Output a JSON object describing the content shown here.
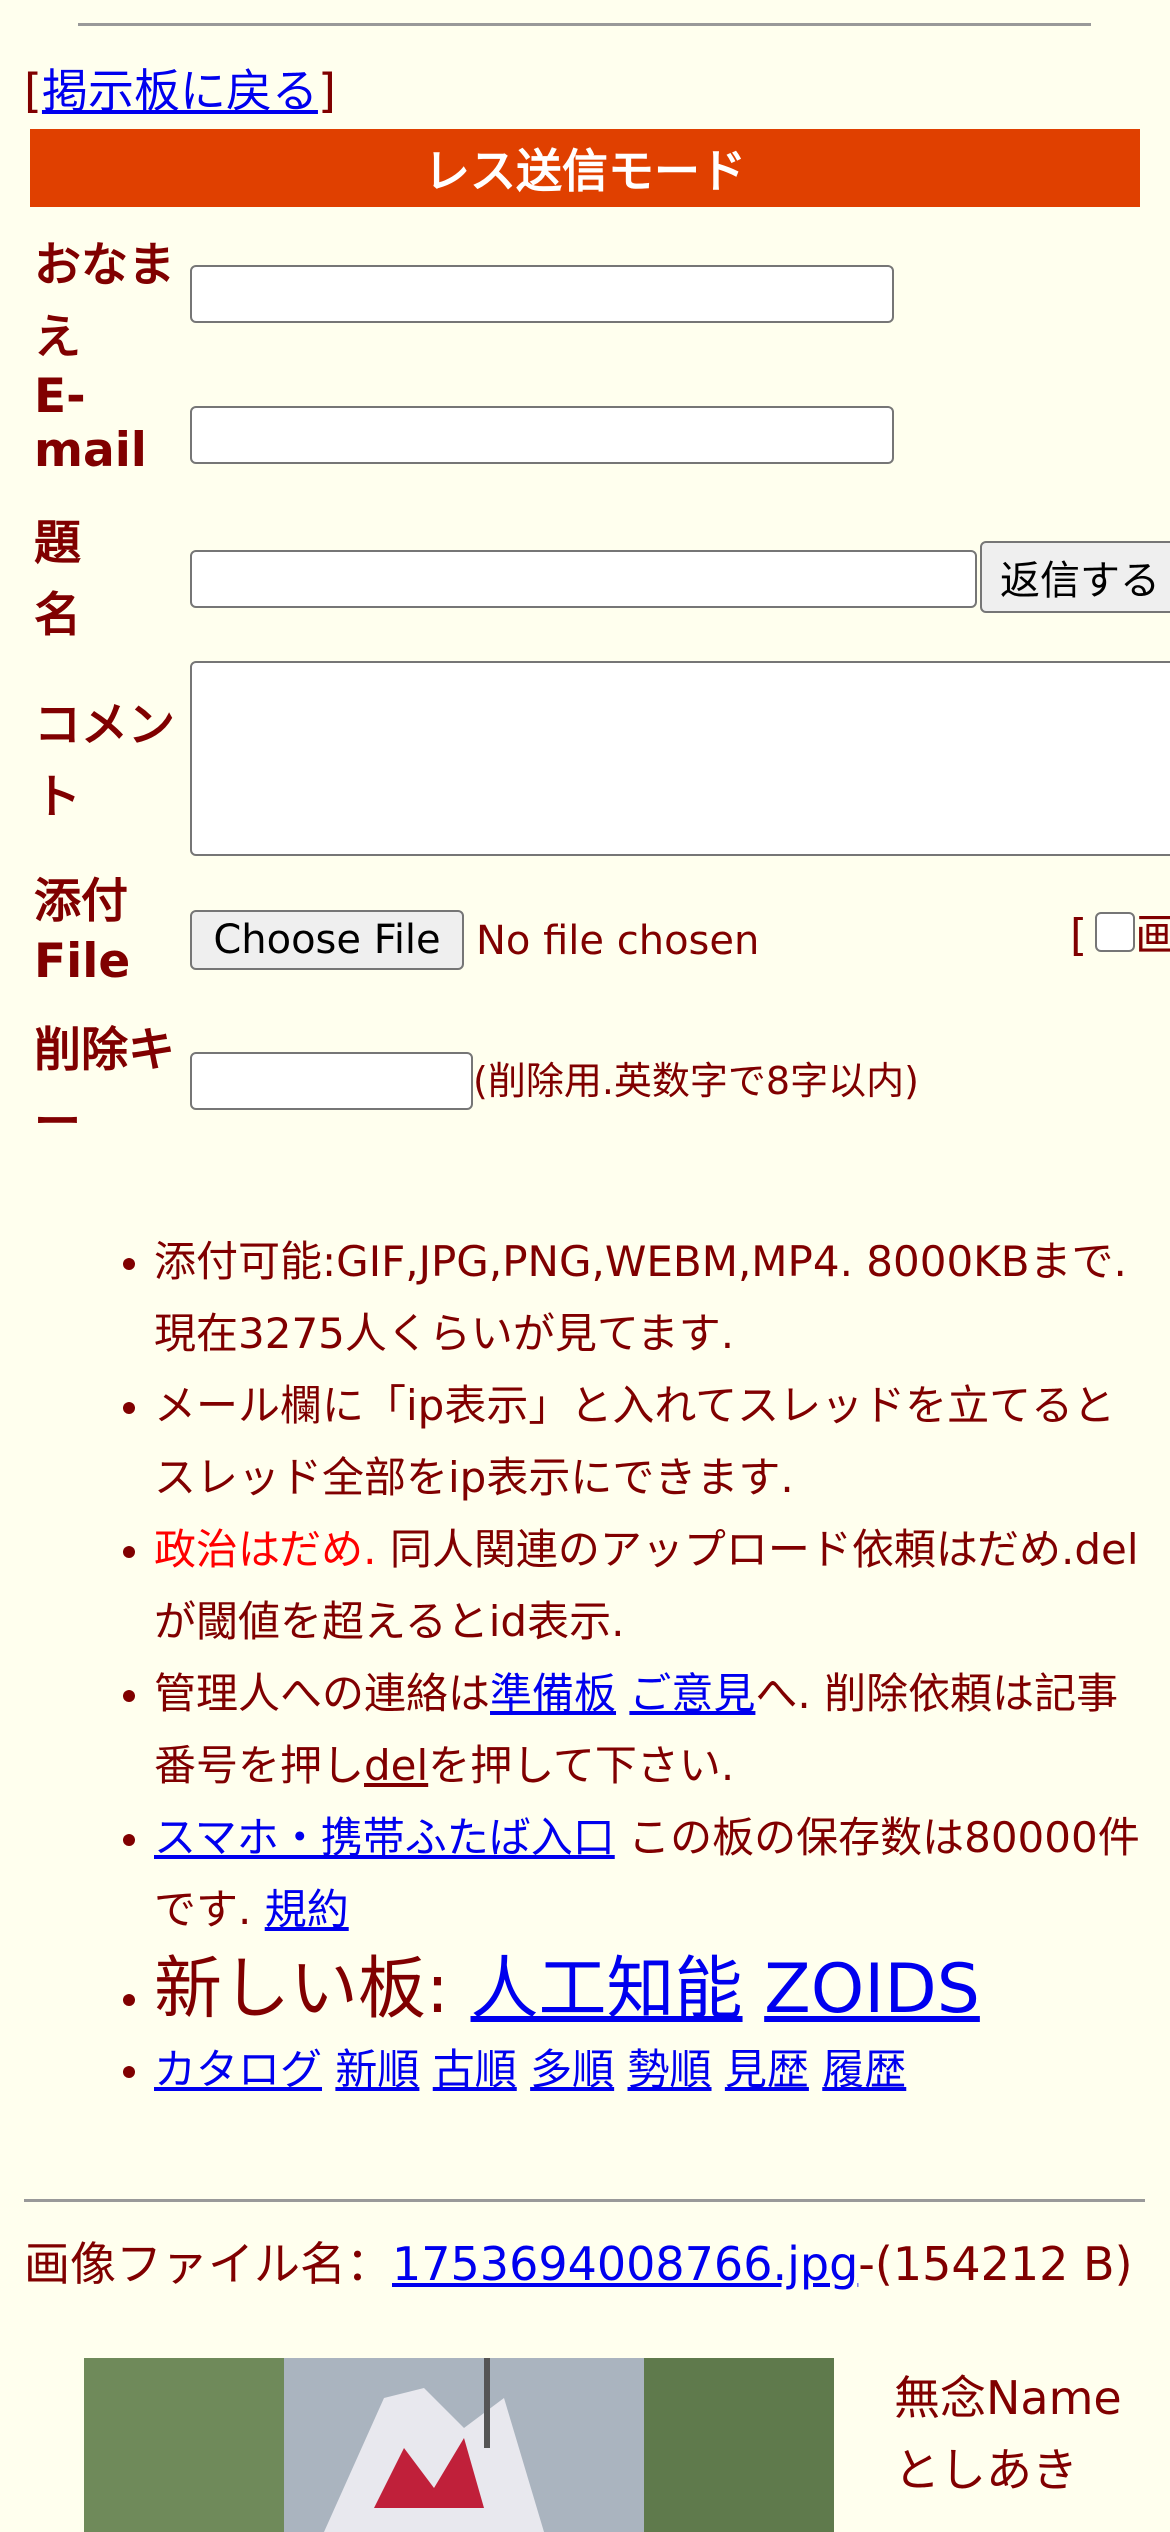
{
  "back_link": {
    "bracket_open": "[",
    "label": "掲示板に戻る",
    "bracket_close": "]"
  },
  "mode_bar": "レス送信モード",
  "form": {
    "name_label": "おなまえ",
    "email_label": "E-mail",
    "subject_label": "題名",
    "submit_label": "返信する",
    "comment_label": "コメント",
    "file_label": "添付File",
    "choose_file_label": "Choose File",
    "no_file_text": "No file chosen",
    "file_tail_text": "[",
    "file_tail_cut": "画",
    "delete_key_label": "削除キー",
    "delete_key_hint": "(削除用.英数字で8字以内)"
  },
  "info": {
    "line1": "添付可能:GIF,JPG,PNG,WEBM,MP4. 8000KBまで. 現在3275人くらいが見てます.",
    "line2": "メール欄に「ip表示」と入れてスレッドを立てるとスレッド全部をip表示にできます.",
    "line3_red": "政治はだめ.",
    "line3_rest": " 同人関連のアップロード依頼はだめ.delが閾値を超えるとid表示.",
    "line4_a": "管理人への連絡は",
    "line4_link1": "準備板",
    "line4_link2": "ご意見",
    "line4_b": "へ. 削除依頼は記事番号を押し",
    "line4_link3": "del",
    "line4_c": "を押して下さい.",
    "line5_link": "スマホ・携帯ふたば入口",
    "line5_text": " この板の保存数は80000件です. ",
    "line5_link2": "規約",
    "line6_text": "新しい板: ",
    "line6_link1": "人工知能",
    "line6_link2": "ZOIDS",
    "nav": [
      "カタログ",
      "新順",
      "古順",
      "多順",
      "勢順",
      "見歴",
      "履歴"
    ]
  },
  "post": {
    "file_prefix": "画像ファイル名：",
    "file_name": "1753694008766.jpg",
    "file_size": "-(154212 B)",
    "name_line1": "無念Name",
    "name_line2": "としあき"
  }
}
